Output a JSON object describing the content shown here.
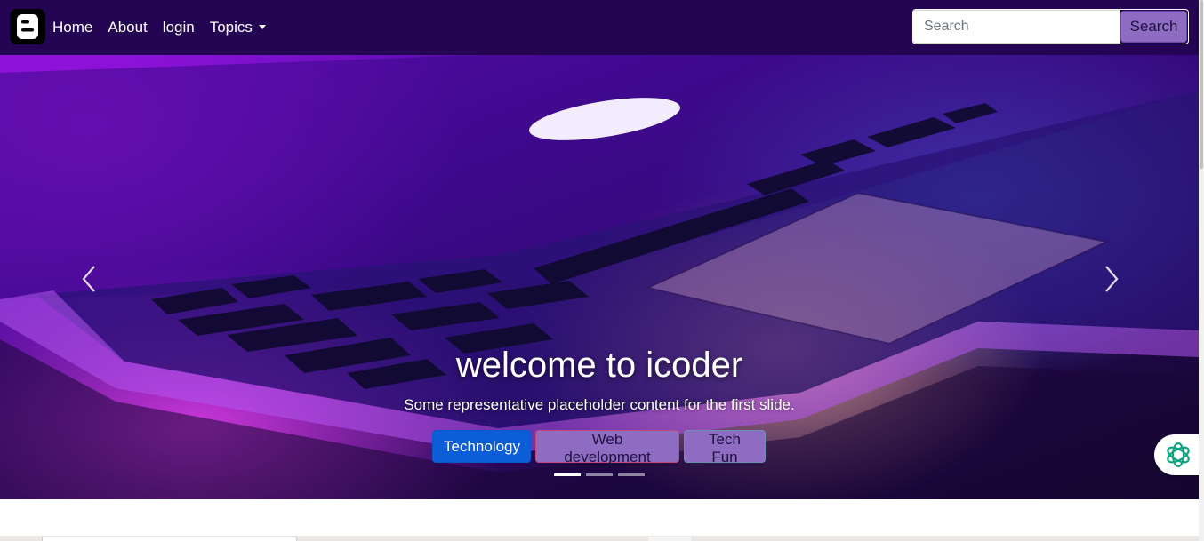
{
  "navbar": {
    "logo_icon": "blogger-b-icon",
    "links": [
      {
        "label": "Home"
      },
      {
        "label": "About"
      },
      {
        "label": "login"
      },
      {
        "label": "Topics"
      }
    ],
    "search": {
      "placeholder": "Search",
      "value": "",
      "button_label": "Search"
    },
    "background": "#230553"
  },
  "carousel": {
    "caption_title": "welcome to icoder",
    "caption_text": "Some representative placeholder content for the first slide.",
    "buttons": [
      {
        "label": "Technology"
      },
      {
        "label": "Web development"
      },
      {
        "label": "Tech Fun"
      }
    ],
    "indicator_count": 3,
    "active_slide": 1,
    "prev_icon": "chevron-left-icon",
    "next_icon": "chevron-right-icon"
  },
  "floating_widget": {
    "icon": "chatgpt-logo-icon",
    "color": "#10a37f"
  },
  "colors": {
    "primary": "#0b5ed7",
    "accent_purple": "#8e6cc1"
  }
}
